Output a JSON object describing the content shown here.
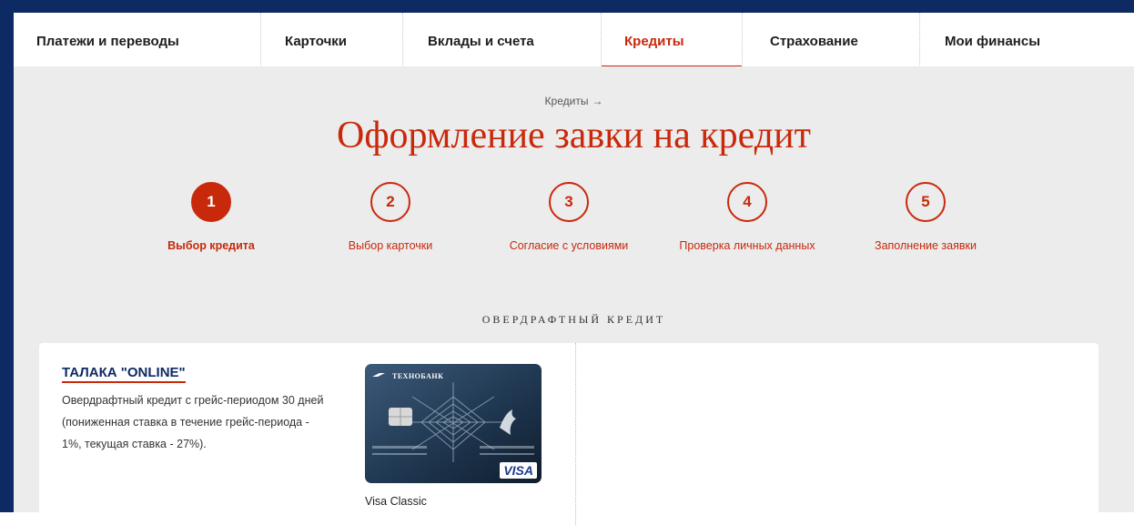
{
  "colors": {
    "brand_red": "#c8290b",
    "navy": "#0d2b62",
    "background": "#ececec"
  },
  "nav": {
    "items": [
      {
        "label": "Платежи и переводы",
        "active": false
      },
      {
        "label": "Карточки",
        "active": false
      },
      {
        "label": "Вклады и счета",
        "active": false
      },
      {
        "label": "Кредиты",
        "active": true
      },
      {
        "label": "Страхование",
        "active": false
      },
      {
        "label": "Мои финансы",
        "active": false
      }
    ]
  },
  "breadcrumb": {
    "label": "Кредиты",
    "arrow": "→"
  },
  "page_title": "Оформление завки на кредит",
  "steps": [
    {
      "number": "1",
      "label": "Выбор кредита",
      "active": true
    },
    {
      "number": "2",
      "label": "Выбор карточки",
      "active": false
    },
    {
      "number": "3",
      "label": "Согласие с условиями",
      "active": false
    },
    {
      "number": "4",
      "label": "Проверка личных данных",
      "active": false
    },
    {
      "number": "5",
      "label": "Заполнение заявки",
      "active": false
    }
  ],
  "section": {
    "heading": "ОВЕРДРАФТНЫЙ КРЕДИТ"
  },
  "product": {
    "title": "ТАЛАКА \"ONLINE\"",
    "description": "Овердрафтный кредит с грейс-периодом 30 дней (пониженная ставка в течение грейс-периода - 1%, текущая ставка - 27%).",
    "card": {
      "bank_name": "ТЕХНОБАНК",
      "brand": "VISA",
      "caption": "Visa Classic"
    }
  }
}
